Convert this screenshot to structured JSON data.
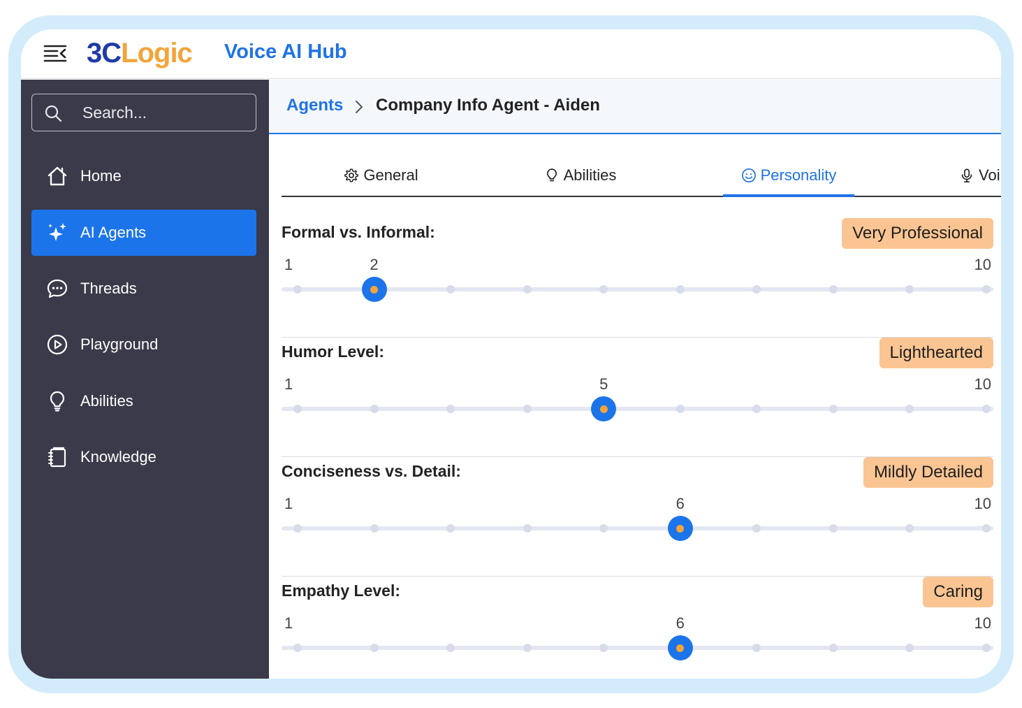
{
  "app": {
    "logo_part1": "3C",
    "logo_part2": "Logic",
    "title": "Voice AI Hub"
  },
  "sidebar": {
    "search_placeholder": "Search...",
    "items": [
      {
        "label": "Home",
        "icon": "home-icon",
        "active": false
      },
      {
        "label": "AI Agents",
        "icon": "sparkles-icon",
        "active": true
      },
      {
        "label": "Threads",
        "icon": "chat-bubble-icon",
        "active": false
      },
      {
        "label": "Playground",
        "icon": "play-circle-icon",
        "active": false
      },
      {
        "label": "Abilities",
        "icon": "lightbulb-icon",
        "active": false
      },
      {
        "label": "Knowledge",
        "icon": "notebook-icon",
        "active": false
      }
    ]
  },
  "breadcrumb": {
    "parent": "Agents",
    "current": "Company Info Agent - Aiden"
  },
  "tabs": [
    {
      "label": "General",
      "icon": "gear-icon",
      "active": false
    },
    {
      "label": "Abilities",
      "icon": "lightbulb-icon",
      "active": false
    },
    {
      "label": "Personality",
      "icon": "smiley-icon",
      "active": true
    },
    {
      "label": "Voi",
      "icon": "microphone-icon",
      "active": false
    }
  ],
  "sliders": [
    {
      "label": "Formal vs. Informal:",
      "badge": "Very Professional",
      "min": 1,
      "max": 10,
      "value": 2
    },
    {
      "label": "Humor Level:",
      "badge": "Lighthearted",
      "min": 1,
      "max": 10,
      "value": 5
    },
    {
      "label": "Conciseness vs. Detail:",
      "badge": "Mildly Detailed",
      "min": 1,
      "max": 10,
      "value": 6
    },
    {
      "label": "Empathy Level:",
      "badge": "Caring",
      "min": 1,
      "max": 10,
      "value": 6
    }
  ],
  "colors": {
    "accent": "#1b74ea",
    "sidebar_bg": "#3a3a4a",
    "badge_bg": "#fbc593",
    "thumb_dot": "#f3a43a",
    "frame_bg": "#d3ecfb"
  }
}
